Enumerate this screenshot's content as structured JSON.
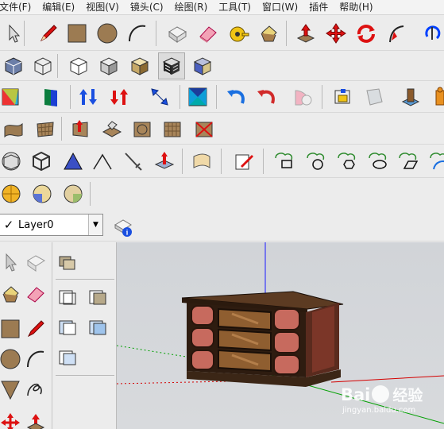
{
  "menu": {
    "items": [
      "文件(F)",
      "编辑(E)",
      "视图(V)",
      "镜头(C)",
      "绘图(R)",
      "工具(T)",
      "窗口(W)",
      "插件",
      "帮助(H)"
    ]
  },
  "layers": {
    "current_layer": "Layer0",
    "checked": "✓"
  },
  "watermark": {
    "brand": "Bai",
    "brand_suffix": "du",
    "suffix_cn": "经验",
    "url": "jingyan.baidu.com"
  },
  "colors": {
    "axis_red": "#d40000",
    "axis_green": "#00a000",
    "axis_blue": "#1a1aff",
    "sky": "#d3d6d9"
  }
}
